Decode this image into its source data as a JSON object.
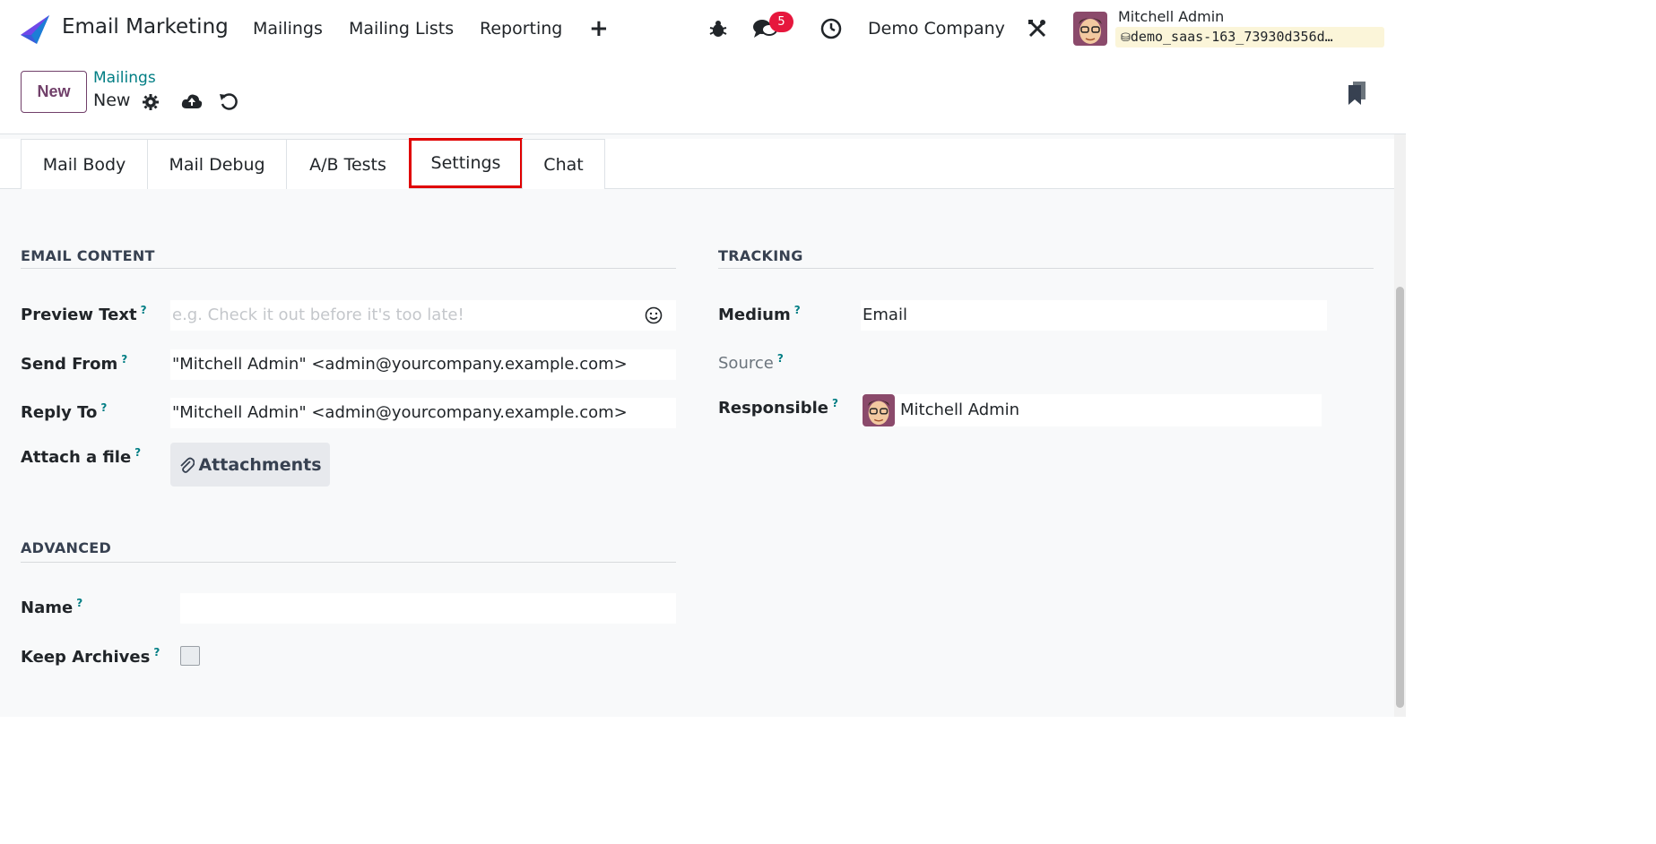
{
  "navbar": {
    "app_name": "Email Marketing",
    "menu": [
      "Mailings",
      "Mailing Lists",
      "Reporting"
    ],
    "add_label": "+",
    "messages_count": "5",
    "company": "Demo Company",
    "user_name": "Mitchell Admin",
    "database": "demo_saas-163_73930d356d…"
  },
  "control_panel": {
    "new_label": "New",
    "breadcrumb_parent": "Mailings",
    "breadcrumb_current": "New"
  },
  "tabs": [
    "Mail Body",
    "Mail Debug",
    "A/B Tests",
    "Settings",
    "Chat"
  ],
  "email_content": {
    "title": "EMAIL CONTENT",
    "preview_text_label": "Preview Text",
    "preview_text_placeholder": "e.g. Check it out before it's too late!",
    "send_from_label": "Send From",
    "send_from_value": "\"Mitchell Admin\" <admin@yourcompany.example.com>",
    "reply_to_label": "Reply To",
    "reply_to_value": "\"Mitchell Admin\" <admin@yourcompany.example.com>",
    "attach_label": "Attach a file",
    "attach_button": "Attachments"
  },
  "tracking": {
    "title": "TRACKING",
    "medium_label": "Medium",
    "medium_value": "Email",
    "source_label": "Source",
    "responsible_label": "Responsible",
    "responsible_value": "Mitchell Admin"
  },
  "advanced": {
    "title": "ADVANCED",
    "name_label": "Name",
    "keep_archives_label": "Keep Archives"
  },
  "help_mark": "?",
  "colors": {
    "brand": "#71406a",
    "link": "#017e84",
    "badge": "#e6173d",
    "highlight": "#e00000"
  }
}
